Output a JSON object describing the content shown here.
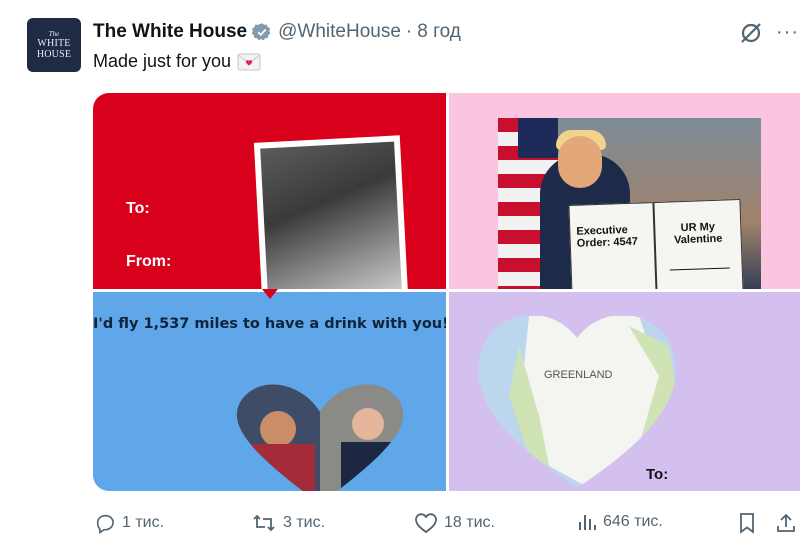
{
  "author": {
    "avatar_line1": "The",
    "avatar_line2": "WHITE HOUSE",
    "name": "The White House",
    "handle": "@WhiteHouse",
    "separator": "·",
    "time": "8 год"
  },
  "tweet": {
    "text": "Made just for you"
  },
  "cards": {
    "card1": {
      "to_label": "To:",
      "from_label": "From:"
    },
    "card2": {
      "doc_left": "Executive Order: 4547",
      "doc_right": "UR My Valentine"
    },
    "card3": {
      "caption": "I'd fly 1,537 miles to have a drink with you!"
    },
    "card4": {
      "to_label": "To:",
      "map_label": "GREENLAND"
    }
  },
  "actions": {
    "replies": "1 тис.",
    "reposts": "3 тис.",
    "likes": "18 тис.",
    "views": "646 тис."
  },
  "colors": {
    "card1_bg": "#d9001b",
    "card2_bg": "#fbc5df",
    "card3_bg": "#5fa7e8",
    "card4_bg": "#d4c0ef",
    "verified": "#829aab"
  },
  "icons": [
    "verified-icon",
    "grok-icon",
    "more-icon",
    "envelope-icon",
    "reply-icon",
    "repost-icon",
    "like-icon",
    "views-icon",
    "bookmark-icon",
    "share-icon"
  ]
}
